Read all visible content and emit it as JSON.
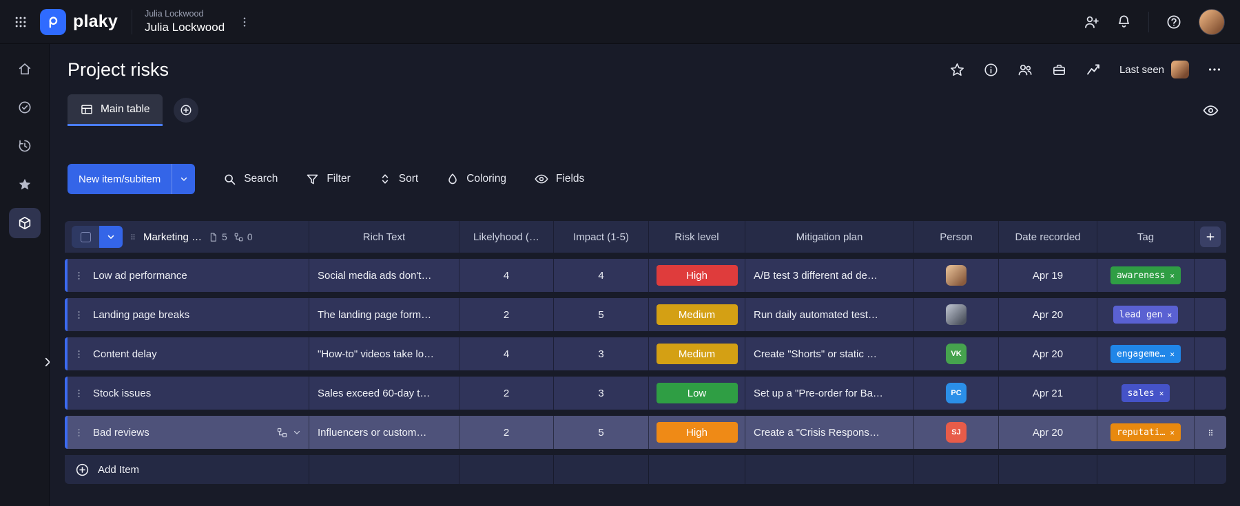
{
  "icons": {
    "close": "✕"
  },
  "topbar": {
    "brand": "plaky",
    "workspace_label": "Julia Lockwood",
    "workspace_name": "Julia Lockwood"
  },
  "page": {
    "title": "Project risks",
    "last_seen_label": "Last seen"
  },
  "tabs": {
    "main_table": "Main table"
  },
  "toolbar": {
    "new_item_label": "New item/subitem",
    "search_label": "Search",
    "filter_label": "Filter",
    "sort_label": "Sort",
    "coloring_label": "Coloring",
    "fields_label": "Fields"
  },
  "table": {
    "group_name": "Marketing …",
    "doc_count": "5",
    "subitem_count": "0",
    "columns": {
      "rich_text": "Rich Text",
      "likelihood": "Likelyhood (…",
      "impact": "Impact (1-5)",
      "risk_level": "Risk level",
      "mitigation": "Mitigation plan",
      "person": "Person",
      "date": "Date recorded",
      "tag": "Tag"
    },
    "rows": [
      {
        "name": "Low ad performance",
        "rich": "Social media ads don't…",
        "likelihood": "4",
        "impact": "4",
        "risk": {
          "label": "High",
          "color": "#df3c3c"
        },
        "mitigation": "A/B test 3 different ad de…",
        "person": {
          "kind": "photo",
          "label": ""
        },
        "date": "Apr 19",
        "tag": {
          "label": "awareness",
          "color": "#2f9e44"
        }
      },
      {
        "name": "Landing page breaks",
        "rich": "The landing page form…",
        "likelihood": "2",
        "impact": "5",
        "risk": {
          "label": "Medium",
          "color": "#d4a014"
        },
        "mitigation": "Run daily automated test…",
        "person": {
          "kind": "photo",
          "label": ""
        },
        "date": "Apr 20",
        "tag": {
          "label": "lead gen",
          "color": "#5a61d2"
        }
      },
      {
        "name": "Content delay",
        "rich": "\"How-to\" videos take lo…",
        "likelihood": "4",
        "impact": "3",
        "risk": {
          "label": "Medium",
          "color": "#d4a014"
        },
        "mitigation": "Create \"Shorts\" or static …",
        "person": {
          "kind": "initials",
          "label": "VK",
          "color": "#46a34e"
        },
        "date": "Apr 20",
        "tag": {
          "label": "engageme…",
          "color": "#2086e8"
        }
      },
      {
        "name": "Stock issues",
        "rich": "Sales exceed 60-day t…",
        "likelihood": "2",
        "impact": "3",
        "risk": {
          "label": "Low",
          "color": "#2f9e44"
        },
        "mitigation": "Set up a \"Pre-order for Ba…",
        "person": {
          "kind": "initials",
          "label": "PC",
          "color": "#2b8fe8"
        },
        "date": "Apr 21",
        "tag": {
          "label": "sales",
          "color": "#4553c8"
        }
      },
      {
        "name": "Bad reviews",
        "rich": "Influencers or custom…",
        "likelihood": "2",
        "impact": "5",
        "risk": {
          "label": "High",
          "color": "#ef8a16"
        },
        "mitigation": "Create a \"Crisis Respons…",
        "person": {
          "kind": "initials",
          "label": "SJ",
          "color": "#e85c49"
        },
        "date": "Apr 20",
        "tag": {
          "label": "reputati…",
          "color": "#e8890f"
        }
      }
    ],
    "add_item_label": "Add Item"
  }
}
